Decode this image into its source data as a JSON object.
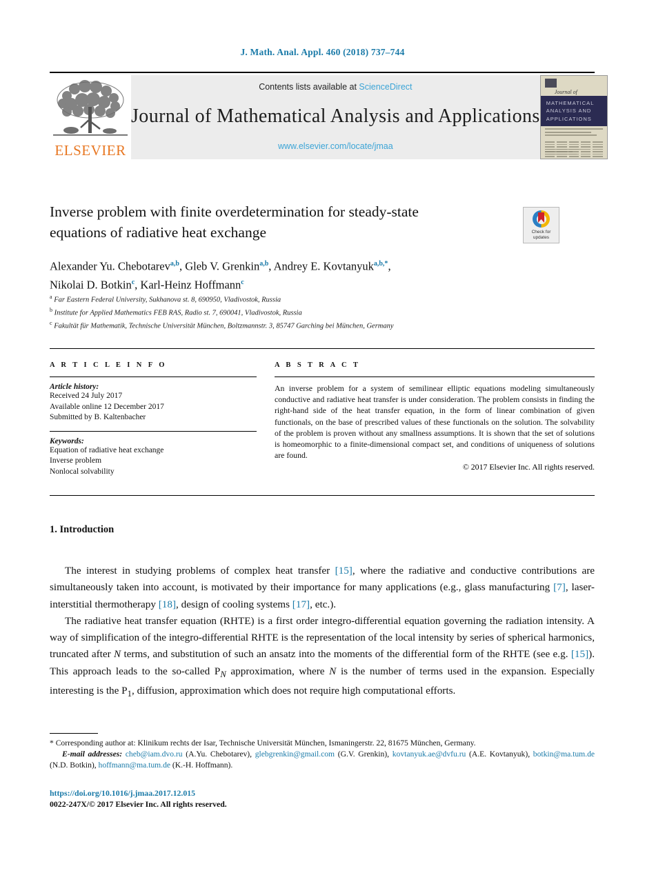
{
  "running_head": "J. Math. Anal. Appl. 460 (2018) 737–744",
  "masthead": {
    "contents_prefix": "Contents lists available at ",
    "sciencedirect": "ScienceDirect",
    "journal_title": "Journal of Mathematical Analysis and Applications",
    "journal_url": "www.elsevier.com/locate/jmaa",
    "publisher_logo_text": "ELSEVIER",
    "cover": {
      "journal_of": "Journal of",
      "cover_title_line1": "MATHEMATICAL",
      "cover_title_line2": "ANALYSIS AND",
      "cover_title_line3": "APPLICATIONS"
    }
  },
  "article": {
    "title_line1": "Inverse problem with finite overdetermination for steady-state",
    "title_line2": "equations of radiative heat exchange",
    "crossmark_label_line1": "Check for",
    "crossmark_label_line2": "updates",
    "authors_line1_a": "Alexander Yu. Chebotarev",
    "authors_line1_a_sup": "a,b",
    "authors_line1_b": "Gleb V. Grenkin",
    "authors_line1_b_sup": "a,b",
    "authors_line1_c": "Andrey E. Kovtanyuk",
    "authors_line1_c_sup": "a,b,*",
    "authors_line2_a": "Nikolai D. Botkin",
    "authors_line2_a_sup": "c",
    "authors_line2_b": "Karl-Heinz Hoffmann",
    "authors_line2_b_sup": "c",
    "affiliations": [
      {
        "mark": "a",
        "text": "Far Eastern Federal University, Sukhanova st. 8, 690950, Vladivostok, Russia"
      },
      {
        "mark": "b",
        "text": "Institute for Applied Mathematics FEB RAS, Radio st. 7, 690041, Vladivostok, Russia"
      },
      {
        "mark": "c",
        "text": "Fakultät für Mathematik, Technische Universität München, Boltzmannstr. 3, 85747 Garching bei München, Germany"
      }
    ]
  },
  "article_info": {
    "heading": "A R T I C L E   I N F O",
    "history_label": "Article history:",
    "history": [
      "Received 24 July 2017",
      "Available online 12 December 2017",
      "Submitted by B. Kaltenbacher"
    ],
    "keywords_label": "Keywords:",
    "keywords": [
      "Equation of radiative heat exchange",
      "Inverse problem",
      "Nonlocal solvability"
    ]
  },
  "abstract": {
    "heading": "A B S T R A C T",
    "text": "An inverse problem for a system of semilinear elliptic equations modeling simultaneously conductive and radiative heat transfer is under consideration. The problem consists in finding the right-hand side of the heat transfer equation, in the form of linear combination of given functionals, on the base of prescribed values of these functionals on the solution. The solvability of the problem is proven without any smallness assumptions. It is shown that the set of solutions is homeomorphic to a finite-dimensional compact set, and conditions of uniqueness of solutions are found.",
    "copyright": "© 2017 Elsevier Inc. All rights reserved."
  },
  "introduction": {
    "heading": "1.  Introduction",
    "p1_pre": "The interest in studying problems of complex heat transfer ",
    "p1_ref1": "[15]",
    "p1_mid1": ", where the radiative and conductive contributions are simultaneously taken into account, is motivated by their importance for many applications (e.g., glass manufacturing ",
    "p1_ref2": "[7]",
    "p1_mid2": ", laser-interstitial thermotherapy ",
    "p1_ref3": "[18]",
    "p1_mid3": ", design of cooling systems ",
    "p1_ref4": "[17]",
    "p1_end": ", etc.).",
    "p2_pre": "The radiative heat transfer equation (RHTE) is a first order integro-differential equation governing the radiation intensity. A way of simplification of the integro-differential RHTE is the representation of the local intensity by series of spherical harmonics, truncated after ",
    "p2_var1": "N",
    "p2_mid1": " terms, and substitution of such an ansatz into the moments of the differential form of the RHTE (see e.g. ",
    "p2_ref1": "[15]",
    "p2_mid2": "). This approach leads to the so-called P",
    "p2_sub1": "N",
    "p2_mid3": " approximation, where ",
    "p2_var2": "N",
    "p2_mid4": " is the number of terms used in the expansion. Especially interesting is the P",
    "p2_sub2": "1",
    "p2_end": ", diffusion, approximation which does not require high computational efforts."
  },
  "footnotes": {
    "corresponding": "* Corresponding author at: Klinikum rechts der Isar, Technische Universität München, Ismaningerstr. 22, 81675 München, Germany.",
    "email_label": "E-mail addresses:",
    "emails": [
      {
        "address": "cheb@iam.dvo.ru",
        "name": "(A.Yu. Chebotarev)"
      },
      {
        "address": "glebgrenkin@gmail.com",
        "name": "(G.V. Grenkin)"
      },
      {
        "address": "kovtanyuk.ae@dvfu.ru",
        "name": "(A.E. Kovtanyuk)"
      },
      {
        "address": "botkin@ma.tum.de",
        "name": "(N.D. Botkin)"
      },
      {
        "address": "hoffmann@ma.tum.de",
        "name": "(K.-H. Hoffmann)."
      }
    ],
    "doi": "https://doi.org/10.1016/j.jmaa.2017.12.015",
    "issn": "0022-247X/© 2017 Elsevier Inc. All rights reserved."
  },
  "colors": {
    "link_blue": "#1a7aa8",
    "sciencedirect_blue": "#3ba4d6",
    "elsevier_orange": "#e87722",
    "cover_navy": "#2b2b52",
    "crossmark_red": "#cf2128"
  }
}
